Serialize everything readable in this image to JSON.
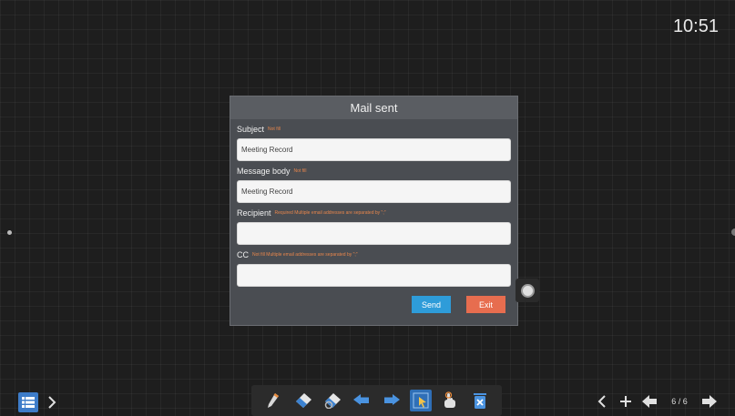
{
  "clock": "10:51",
  "dialog": {
    "title": "Mail sent",
    "fields": [
      {
        "label": "Subject",
        "hint": "Not fill",
        "value": "Meeting Record"
      },
      {
        "label": "Message body",
        "hint": "Not fill",
        "value": "Meeting Record"
      },
      {
        "label": "Recipient",
        "hint": "Required  Multiple email addresses are separated by \";\"",
        "value": ""
      },
      {
        "label": "CC",
        "hint": "Not fill  Multiple email addresses are separated by \";\"",
        "value": ""
      }
    ],
    "send_label": "Send",
    "exit_label": "Exit"
  },
  "toolbar": {
    "tools": [
      "pen-icon",
      "eraser-icon",
      "clear-eraser-icon",
      "undo-icon",
      "redo-icon",
      "select-icon",
      "hand-icon",
      "delete-icon"
    ],
    "active_tool": "select-icon"
  },
  "pager": {
    "indicator": "6 / 6"
  },
  "colors": {
    "dialog_bg": "#4a4d52",
    "send": "#2e9cd9",
    "exit": "#e76d4f",
    "hint": "#e8864c",
    "accent": "#3d7cc9"
  }
}
